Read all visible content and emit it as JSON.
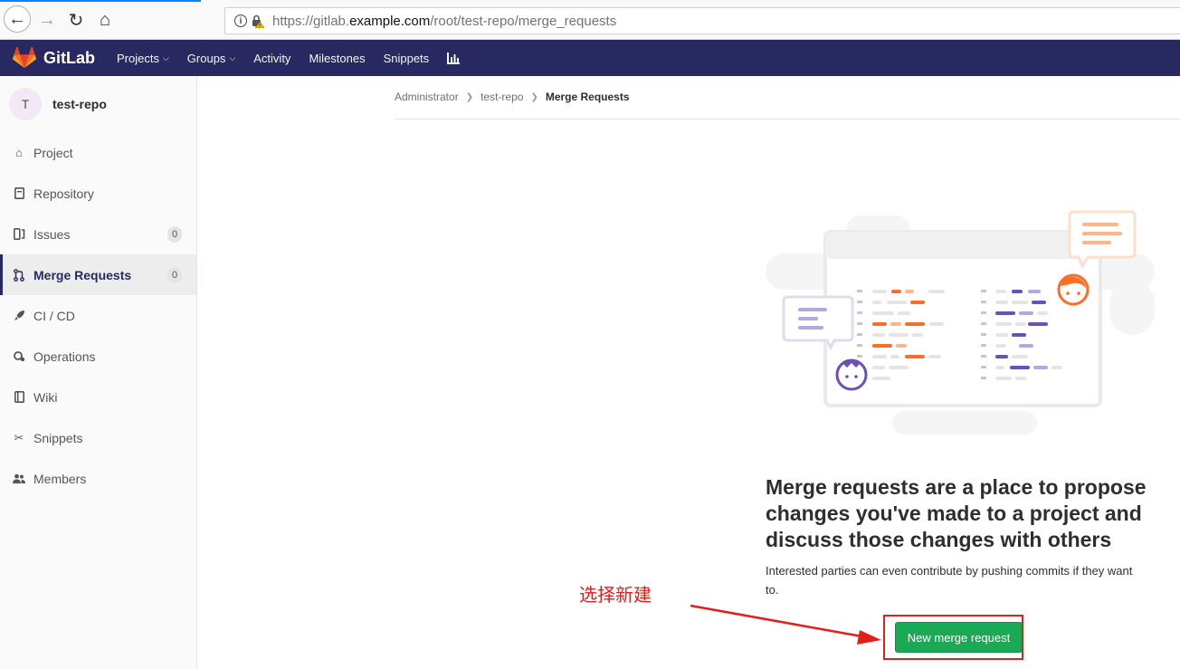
{
  "browser": {
    "url_prefix": "https://gitlab.",
    "url_domain": "example.com",
    "url_path": "/root/test-repo/merge_requests"
  },
  "header": {
    "logo_text": "GitLab",
    "nav": [
      "Projects",
      "Groups",
      "Activity",
      "Milestones",
      "Snippets"
    ]
  },
  "sidebar": {
    "avatar_letter": "T",
    "project_name": "test-repo",
    "items": [
      {
        "label": "Project"
      },
      {
        "label": "Repository"
      },
      {
        "label": "Issues",
        "badge": "0"
      },
      {
        "label": "Merge Requests",
        "badge": "0"
      },
      {
        "label": "CI / CD"
      },
      {
        "label": "Operations"
      },
      {
        "label": "Wiki"
      },
      {
        "label": "Snippets"
      },
      {
        "label": "Members"
      }
    ]
  },
  "breadcrumb": [
    "Administrator",
    "test-repo",
    "Merge Requests"
  ],
  "empty_state": {
    "title": "Merge requests are a place to propose changes you've made to a project and discuss those changes with others",
    "description": "Interested parties can even contribute by pushing commits if they want to.",
    "button_label": "New merge request"
  },
  "annotation": {
    "text": "选择新建",
    "color": "#e1201c"
  },
  "colors": {
    "header_bg": "#292961",
    "button_green": "#1aaa55",
    "orange": "#fc6d26",
    "purple": "#6b4fbb"
  }
}
